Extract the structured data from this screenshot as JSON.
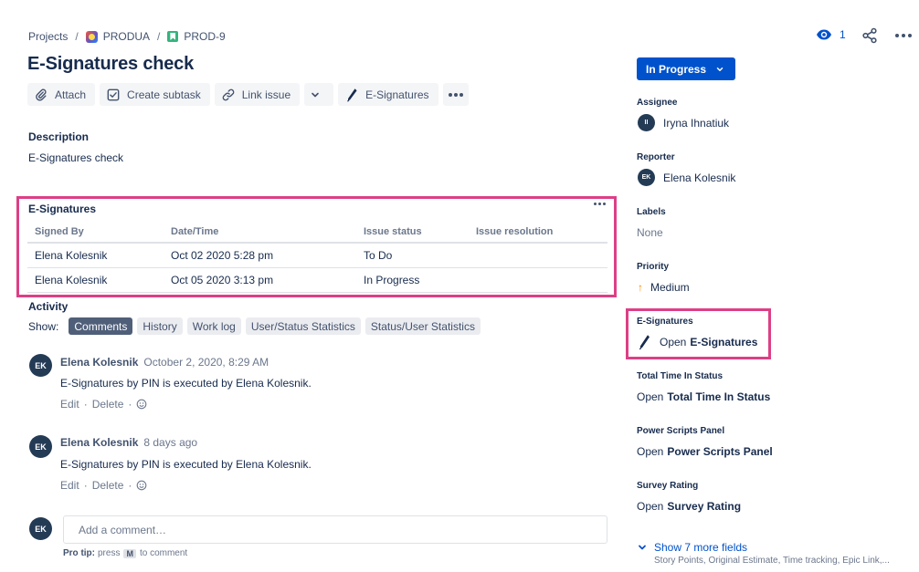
{
  "breadcrumb": {
    "root": "Projects",
    "project": "PRODUA",
    "issue_key": "PROD-9",
    "separator": "/"
  },
  "issue": {
    "title": "E-Signatures check"
  },
  "toolbar": {
    "attach": "Attach",
    "create_subtask": "Create subtask",
    "link_issue": "Link issue",
    "esignatures": "E-Signatures"
  },
  "description": {
    "label": "Description",
    "text": "E-Signatures check"
  },
  "esig_panel": {
    "title": "E-Signatures",
    "headers": [
      "Signed By",
      "Date/Time",
      "Issue status",
      "Issue resolution"
    ],
    "rows": [
      [
        "Elena Kolesnik",
        "Oct 02 2020 5:28 pm",
        "To Do",
        ""
      ],
      [
        "Elena Kolesnik",
        "Oct 05 2020 3:13 pm",
        "In Progress",
        ""
      ]
    ]
  },
  "activity": {
    "label": "Activity",
    "show_label": "Show:",
    "filters": [
      "Comments",
      "History",
      "Work log",
      "User/Status Statistics",
      "Status/User Statistics"
    ],
    "active_filter": "Comments",
    "comments": [
      {
        "initials": "EK",
        "author": "Elena Kolesnik",
        "time": "October 2, 2020, 8:29 AM",
        "text": "E-Signatures by PIN is executed by Elena Kolesnik.",
        "edit": "Edit",
        "delete": "Delete",
        "bullet": "·"
      },
      {
        "initials": "EK",
        "author": "Elena Kolesnik",
        "time": "8 days ago",
        "text": "E-Signatures by PIN is executed by Elena Kolesnik.",
        "edit": "Edit",
        "delete": "Delete",
        "bullet": "·"
      }
    ],
    "add_comment_placeholder": "Add a comment…",
    "current_user_initials": "EK",
    "protip_bold": "Pro tip:",
    "protip_pre": "press",
    "protip_key": "M",
    "protip_post": "to comment"
  },
  "header_actions": {
    "watchers_count": "1",
    "icons": [
      "eye-icon",
      "share-icon",
      "more-icon"
    ]
  },
  "sidebar": {
    "status": "In Progress",
    "assignee": {
      "label": "Assignee",
      "initials": "II",
      "name": "Iryna Ihnatiuk"
    },
    "reporter": {
      "label": "Reporter",
      "initials": "EK",
      "name": "Elena Kolesnik"
    },
    "labels": {
      "label": "Labels",
      "value": "None"
    },
    "priority": {
      "label": "Priority",
      "value": "Medium",
      "arrow": "↑"
    },
    "esignatures": {
      "label": "E-Signatures",
      "prefix": "Open",
      "link": "E-Signatures"
    },
    "total_time": {
      "label": "Total Time In Status",
      "prefix": "Open",
      "link": "Total Time In Status"
    },
    "power_scripts": {
      "label": "Power Scripts Panel",
      "prefix": "Open",
      "link": "Power Scripts Panel"
    },
    "survey": {
      "label": "Survey Rating",
      "prefix": "Open",
      "link": "Survey Rating"
    },
    "show_more": "Show 7 more fields",
    "show_more_sub": "Story Points, Original Estimate, Time tracking, Epic Link,..."
  },
  "colors": {
    "primary": "#0052cc",
    "highlight": "#dd3f86",
    "story": "#36b37e",
    "priority_medium": "#ff8b00",
    "text": "#172b4d",
    "subtle": "#6b778c"
  }
}
